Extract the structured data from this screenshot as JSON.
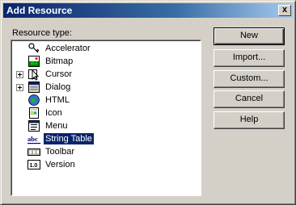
{
  "window": {
    "title": "Add Resource",
    "close_glyph": "x"
  },
  "tree": {
    "label": "Resource type:",
    "items": [
      {
        "label": "Accelerator",
        "icon": "accelerator-icon",
        "expandable": false,
        "selected": false
      },
      {
        "label": "Bitmap",
        "icon": "bitmap-icon",
        "expandable": false,
        "selected": false
      },
      {
        "label": "Cursor",
        "icon": "cursor-icon",
        "expandable": true,
        "selected": false
      },
      {
        "label": "Dialog",
        "icon": "dialog-icon",
        "expandable": true,
        "selected": false
      },
      {
        "label": "HTML",
        "icon": "html-icon",
        "expandable": false,
        "selected": false
      },
      {
        "label": "Icon",
        "icon": "icon-resource-icon",
        "expandable": false,
        "selected": false
      },
      {
        "label": "Menu",
        "icon": "menu-icon",
        "expandable": false,
        "selected": false
      },
      {
        "label": "String Table",
        "icon": "string-table-icon",
        "expandable": false,
        "selected": true
      },
      {
        "label": "Toolbar",
        "icon": "toolbar-icon",
        "expandable": false,
        "selected": false
      },
      {
        "label": "Version",
        "icon": "version-icon",
        "expandable": false,
        "selected": false
      }
    ]
  },
  "buttons": {
    "new": "New",
    "import": "Import...",
    "custom": "Custom...",
    "cancel": "Cancel",
    "help": "Help"
  },
  "colors": {
    "title_bar": "#0a246a",
    "face": "#d4d0c8",
    "selection": "#0a246a"
  }
}
